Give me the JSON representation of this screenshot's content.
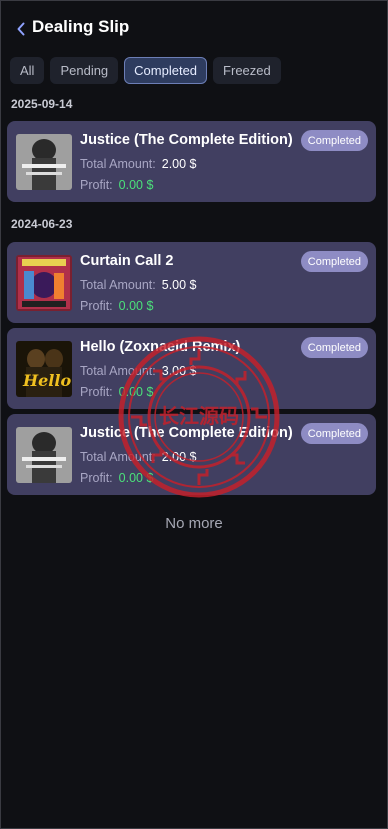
{
  "header": {
    "title": "Dealing Slip",
    "back_icon": "chevron-left-icon"
  },
  "tabs": [
    {
      "label": "All",
      "active": false
    },
    {
      "label": "Pending",
      "active": false
    },
    {
      "label": "Completed",
      "active": true
    },
    {
      "label": "Freezed",
      "active": false
    }
  ],
  "groups": [
    {
      "date": "2025-09-14",
      "items": [
        {
          "name": "Justice (The Complete Edition)",
          "status": "Completed",
          "amount_label": "Total Amount:",
          "amount": "2.00 $",
          "profit_label": "Profit:",
          "profit": "0.00 $"
        }
      ]
    },
    {
      "date": "2024-06-23",
      "items": [
        {
          "name": "Curtain Call 2",
          "status": "Completed",
          "amount_label": "Total Amount:",
          "amount": "5.00 $",
          "profit_label": "Profit:",
          "profit": "0.00 $"
        },
        {
          "name": "Hello (Zoxnaeid Remix)",
          "status": "Completed",
          "amount_label": "Total Amount:",
          "amount": "3.00 $",
          "profit_label": "Profit:",
          "profit": "0.00 $",
          "cover_text": "Hello"
        },
        {
          "name": "Justice (The Complete Edition)",
          "status": "Completed",
          "amount_label": "Total Amount:",
          "amount": "2.00 $",
          "profit_label": "Profit:",
          "profit": "0.00 $"
        }
      ]
    }
  ],
  "footer": {
    "no_more": "No more"
  },
  "watermark": {
    "text": "长江源码"
  },
  "colors": {
    "background": "#0f1014",
    "card": "#413f61",
    "badge": "#8e8cc4",
    "profit": "#4be07a",
    "active_tab": "#2e3c5f",
    "seal": "#c8202a"
  }
}
